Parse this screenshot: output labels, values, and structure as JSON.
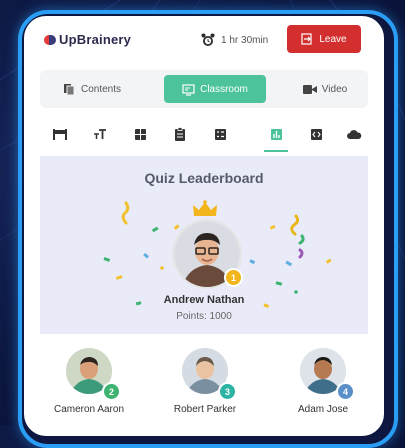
{
  "header": {
    "logo_text": "UpBrainery",
    "timer": "1 hr 30min",
    "leave_label": "Leave"
  },
  "tabs": [
    {
      "label": "Contents",
      "icon": "documents-icon",
      "active": false
    },
    {
      "label": "Classroom",
      "icon": "classroom-icon",
      "active": true
    },
    {
      "label": "Video",
      "icon": "video-camera-icon",
      "active": false
    }
  ],
  "toolbar": {
    "icons": [
      "desk-icon",
      "text-size-icon",
      "grid-icon",
      "clipboard-icon",
      "checklist-icon",
      "bar-chart-icon",
      "code-icon",
      "cloud-icon"
    ],
    "active_icon": "bar-chart-icon"
  },
  "leaderboard": {
    "title": "Quiz Leaderboard",
    "winner": {
      "name": "Andrew Nathan",
      "points": "Points: 1000",
      "rank": "1"
    },
    "runners": [
      {
        "name": "Cameron Aaron",
        "rank": "2"
      },
      {
        "name": "Robert Parker",
        "rank": "3"
      },
      {
        "name": "Adam Jose",
        "rank": "4"
      }
    ]
  },
  "colors": {
    "accent": "#4cc39a",
    "leave": "#d32f2f",
    "board_bg": "#e9ebf8",
    "gold": "#f2b51c",
    "bronze": "#2bb3a4",
    "green": "#3cb371"
  }
}
